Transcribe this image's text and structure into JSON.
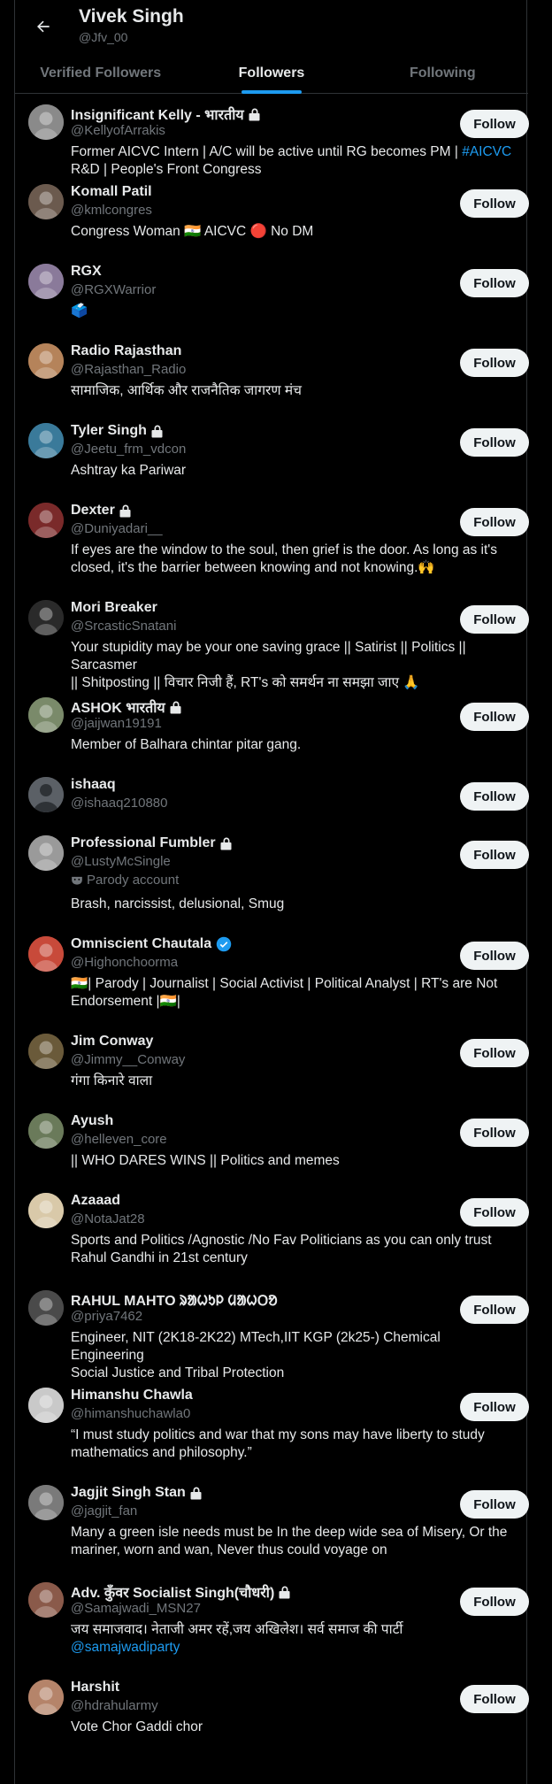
{
  "profile": {
    "name": "Vivek Singh",
    "handle": "@Jfv_00"
  },
  "tabs": [
    "Verified Followers",
    "Followers",
    "Following"
  ],
  "active_tab": 1,
  "follow_label": "Follow",
  "parody_label": "Parody account",
  "colors": {
    "background": "#000000",
    "text": "#e7e9ea",
    "muted": "#71767b",
    "accent": "#1d9bf0",
    "divider": "#2f3336",
    "button": "#eff3f4"
  },
  "followers": [
    {
      "name": "Insignificant Kelly - भारतीय",
      "handle": "@KellyofArrakis",
      "locked": true,
      "bio": "Former AICVC Intern | A/C will be active until RG becomes PM | ",
      "bio_link": "#AICVC",
      "bio2": "R&D | People's Front Congress"
    },
    {
      "name": "Komall Patil",
      "handle": "@kmlcongres",
      "bio": "Congress Woman 🇮🇳 AICVC 🔴 No DM"
    },
    {
      "name": "RGX",
      "handle": "@RGXWarrior",
      "bio": "🗳️"
    },
    {
      "name": "Radio Rajasthan",
      "handle": "@Rajasthan_Radio",
      "bio": "सामाजिक, आर्थिक और राजनैतिक जागरण मंच"
    },
    {
      "name": "Tyler Singh",
      "handle": "@Jeetu_frm_vdcon",
      "locked": true,
      "bio": "Ashtray ka Pariwar"
    },
    {
      "name": "Dexter",
      "handle": "@Duniyadari__",
      "locked": true,
      "bio": "If eyes are the window to the soul, then grief is the door. As long as it's",
      "bio2": "closed, it's the barrier between knowing and not knowing.🙌"
    },
    {
      "name": "Mori Breaker",
      "handle": "@SrcasticSnatani",
      "bio": "Your stupidity may be your one saving grace || Satirist || Politics || Sarcasmer",
      "bio2": "|| Shitposting || विचार निजी हैं, RT's को समर्थन ना समझा जाए 🙏"
    },
    {
      "name": "ASHOK भारतीय",
      "handle": "@jaijwan19191",
      "locked": true,
      "bio": "Member of Balhara chintar pitar gang."
    },
    {
      "name": "ishaaq",
      "handle": "@ishaaq210880",
      "bio": ""
    },
    {
      "name": "Professional Fumbler",
      "handle": "@LustyMcSingle",
      "locked": true,
      "parody": true,
      "bio": "Brash, narcissist, delusional, Smug"
    },
    {
      "name": "Omniscient Chautala",
      "handle": "@Highonchoorma",
      "verified": true,
      "bio": "🇮🇳| Parody | Journalist | Social Activist | Political Analyst | RT's are Not",
      "bio2": "Endorsement |🇮🇳|"
    },
    {
      "name": "Jim Conway",
      "handle": "@Jimmy__Conway",
      "bio": "गंगा किनारे वाला"
    },
    {
      "name": "Ayush",
      "handle": "@helleven_core",
      "bio": "|| WHO DARES WINS || Politics and memes"
    },
    {
      "name": "Azaaad",
      "handle": "@NotaJat28",
      "bio": "Sports and Politics /Agnostic /No Fav Politicians as you can only trust",
      "bio2": "Rahul Gandhi in 21st century"
    },
    {
      "name": "RAHUL MAHTO ᱨᱟᱦᱩᱞ ᱢᱟᱦᱛᱚ",
      "handle": "@priya7462",
      "bio": "Engineer, NIT (2K18-2K22) MTech,IIT KGP (2k25-) Chemical Engineering",
      "bio2": "Social Justice and Tribal Protection"
    },
    {
      "name": "Himanshu Chawla",
      "handle": "@himanshuchawla0",
      "bio": "“I must study politics and war that my sons may have liberty to study",
      "bio2": "mathematics and philosophy.”"
    },
    {
      "name": "Jagjit Singh Stan",
      "handle": "@jagjit_fan",
      "locked": true,
      "bio": "Many a green isle needs must be In the deep wide sea of Misery, Or the",
      "bio2": "mariner, worn and wan, Never thus could voyage on"
    },
    {
      "name": "Adv. कुँवर Socialist Singh(चौधरी)",
      "handle": "@Samajwadi_MSN27",
      "locked": true,
      "bio": "जय समाजवाद। नेताजी अमर रहें,जय अखिलेश। सर्व समाज की पार्टी ",
      "bio_link": "@samajwadiparty"
    },
    {
      "name": "Harshit",
      "handle": "@hdrahularmy",
      "bio": "Vote Chor Gaddi chor"
    }
  ]
}
